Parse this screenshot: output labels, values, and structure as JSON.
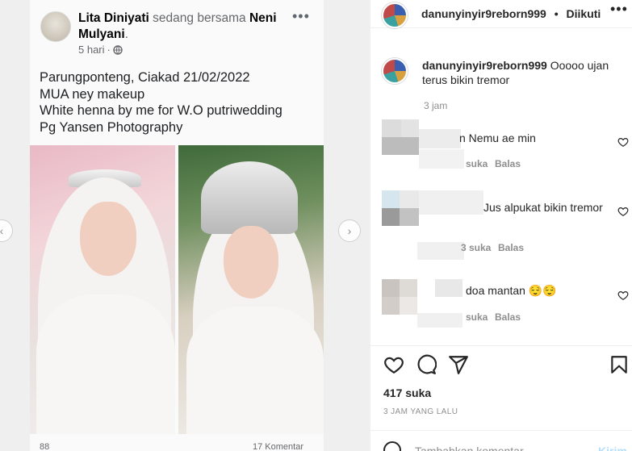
{
  "post_media": {
    "fb_post": {
      "author": "Lita Diniyati",
      "with_text": "sedang bersama",
      "tagged": "Neni Mulyani",
      "tagged_suffix": ".",
      "time": "5 hari",
      "caption_lines": [
        "Parungponteng, Ciakad 21/02/2022",
        "MUA ney makeup",
        "White henna by me for W.O putriwedding",
        "Pg Yansen Photography"
      ],
      "reactions_count": "88",
      "comments_count": "17 Komentar"
    }
  },
  "header": {
    "username": "danunyinyir9reborn999",
    "separator": "•",
    "follow_label": "Diikuti"
  },
  "caption": {
    "username": "danunyinyir9reborn999",
    "text": "Ooooo ujan terus bikin tremor",
    "time": "3 jam"
  },
  "comments": [
    {
      "text": "n Nemu ae min",
      "likes": "suka",
      "reply": "Balas"
    },
    {
      "text": "Jus alpukat bikin tremor",
      "likes": "3 suka",
      "reply": "Balas"
    },
    {
      "text": "doa mantan 😌😌",
      "likes": "suka",
      "reply": "Balas"
    }
  ],
  "stats": {
    "likes": "417 suka",
    "ago": "3 JAM YANG LALU"
  },
  "add_comment": {
    "placeholder": "Tambahkan komentar...",
    "send_label": "Kirim"
  },
  "icons": [
    "heart-icon",
    "comment-icon",
    "share-icon",
    "bookmark-icon",
    "more-icon",
    "globe-icon",
    "emoji-icon",
    "chevron-left-icon",
    "chevron-right-icon"
  ]
}
